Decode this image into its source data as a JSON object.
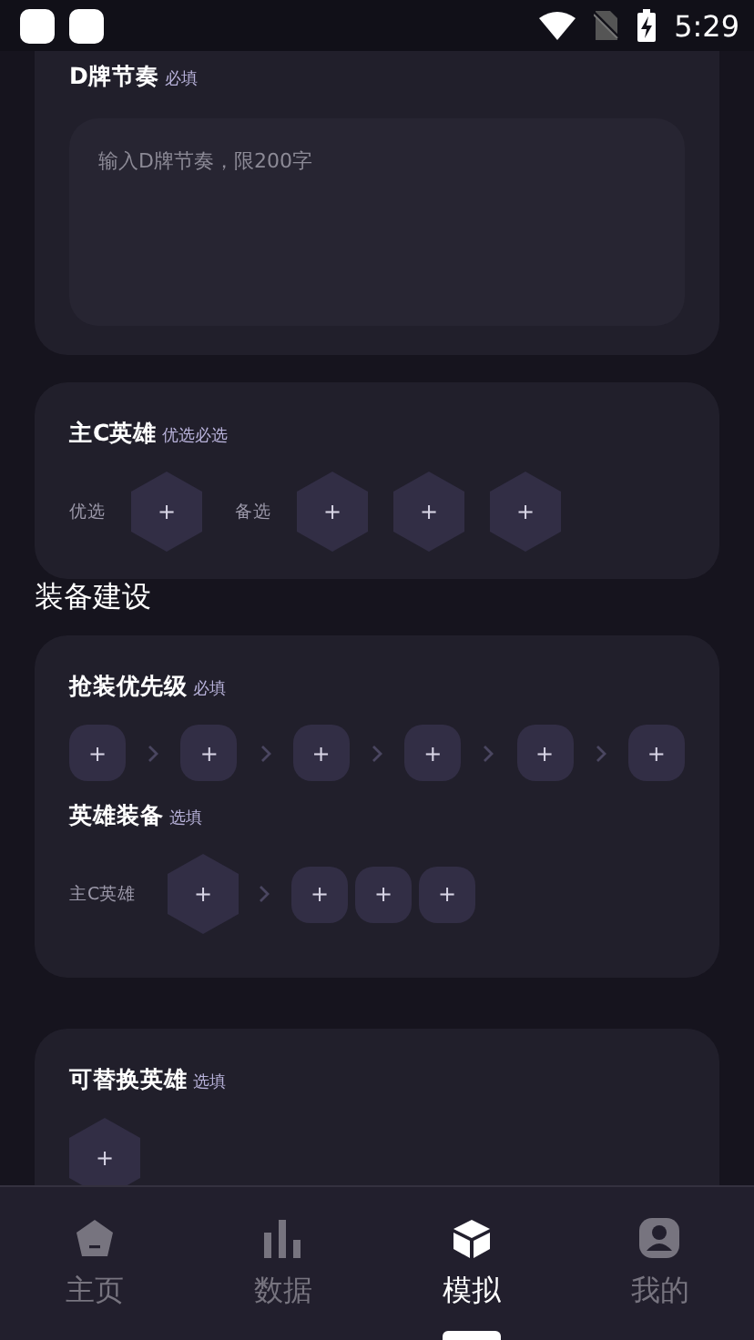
{
  "status_bar": {
    "time": "5:29"
  },
  "rhythm": {
    "title": "D牌节奏",
    "tag": "必填",
    "placeholder": "输入D牌节奏，限200字"
  },
  "main_carry": {
    "title": "主C英雄",
    "tag": "优选必选",
    "groups": [
      {
        "label": "优选",
        "slots": [
          "+"
        ]
      },
      {
        "label": "备选",
        "slots": [
          "+",
          "+",
          "+"
        ]
      }
    ]
  },
  "section_title": "装备建设",
  "equipment": {
    "priority": {
      "title": "抢装优先级",
      "tag": "必填",
      "slots": [
        "+",
        "+",
        "+",
        "+",
        "+",
        "+"
      ]
    },
    "hero_gear": {
      "title": "英雄装备",
      "tag": "选填",
      "hero_label": "主C英雄",
      "hero_slot": "+",
      "item_slots": [
        "+",
        "+",
        "+"
      ]
    }
  },
  "substitutes": {
    "title": "可替换英雄",
    "tag": "选填",
    "slots": [
      "+"
    ]
  },
  "tabs": [
    {
      "label": "主页",
      "kind": "home",
      "selected": false
    },
    {
      "label": "数据",
      "kind": "stats",
      "selected": false
    },
    {
      "label": "模拟",
      "kind": "cube",
      "selected": true
    },
    {
      "label": "我的",
      "kind": "profile",
      "selected": false
    }
  ]
}
